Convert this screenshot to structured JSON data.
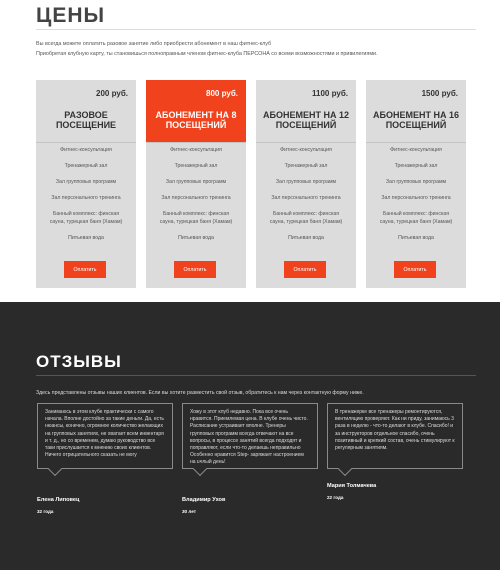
{
  "prices": {
    "title": "ЦЕНЫ",
    "intro_line1": "Вы всегда можете оплатить разовое занятие либо приобрести абонемент в наш фитнес-клуб",
    "intro_line2": "Приобретая клубную карту, ты становишься полноправным членом фитнес-клуба ПЕРСОНА со всеми возможностями и привилегиями."
  },
  "plans": [
    {
      "price": "200 руб.",
      "name1": "РАЗОВОЕ",
      "name2": "ПОСЕЩЕНИЕ",
      "featured": false,
      "button": "Оплатить"
    },
    {
      "price": "800 руб.",
      "name1": "АБОНЕМЕНТ НА 8",
      "name2": "ПОСЕЩЕНИЙ",
      "featured": true,
      "button": "Оплатить"
    },
    {
      "price": "1100 руб.",
      "name1": "АБОНЕМЕНТ НА 12",
      "name2": "ПОСЕЩЕНИЙ",
      "featured": false,
      "button": "Оплатить"
    },
    {
      "price": "1500 руб.",
      "name1": "АБОНЕМЕНТ НА 16",
      "name2": "ПОСЕЩЕНИЙ",
      "featured": false,
      "button": "Оплатить"
    }
  ],
  "features": {
    "f1": "Фитнес-консультация",
    "f2": "Тренажерный зал",
    "f3": "Зал групповых программ",
    "f4": "Зал персонального тренинга",
    "f5a": "Банный комплекс: финская",
    "f5b": "сауна, турецкая баня (Хамам)",
    "f6": "Питьевая вода"
  },
  "reviews": {
    "title": "ОТЗЫВЫ",
    "intro": "Здесь представлены отзывы наших клиентов. Если вы хотите разместить свой отзыв, обратитесь к нам через контактную форму ниже.",
    "items": [
      {
        "text": "Занимаюсь в этом клубе практически с самого начала. Вполне достойно за такие деньги. Да, есть нюансы, конечно, огромное количество желающих на групповых занятиях, не хватает всем инвентаря и т. д., но со временем, думаю руководство все таки прислушается к мнению своих клиентов. Ничего отрицательного сказать не могу",
        "name": "Елена Липовец",
        "age": "32 года"
      },
      {
        "text": "Хожу в этот клуб недавно. Пока все очень нравится. Приемлемая цена. В клубе очень чисто. Расписание устраивает вполне. Тренеры групповых программ всегда отвечают на все вопросы, в процессе занятий всегда подходят и поправляют, если что-то делаешь неправильно Особенно нравится Step- заряжает настроением на целый день!",
        "name": "Владимир Ухов",
        "age": "30 лет"
      },
      {
        "text": "В тренажерке все тренажеры ремонтируются, вентиляцию проверяют. Как ни приду, занимаюсь 3 раза в неделю - что-то делают в клубе. Спасибо! и за инструкторов отдельное спасибо, очень позитивный и крепкий состав, очень стимулируют к регулярным занятиям.",
        "name": "Мария Толмачева",
        "age": "22 года"
      }
    ]
  },
  "colors": {
    "accent": "#f0421c",
    "card_bg": "#dcdcdc",
    "dark_bg": "#2a2a2a"
  }
}
